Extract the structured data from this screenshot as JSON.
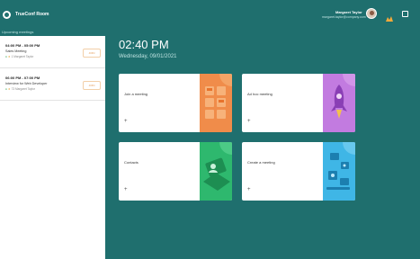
{
  "app": {
    "title": "TrueConf Room"
  },
  "user": {
    "name": "Margaret Taylor",
    "email": "margaret.taylor@company.com"
  },
  "sidebar": {
    "header": "Upcoming meetings",
    "meetings": [
      {
        "time": "04:00 PM - 05:00 PM",
        "title": "Sales Meeting",
        "meta": "1  Margaret Taylor",
        "button": "JOIN"
      },
      {
        "time": "06:00 PM - 07:00 PM",
        "title": "Interview for Web Developer",
        "meta": "73  Margaret Taylor",
        "button": "JOIN"
      }
    ]
  },
  "main": {
    "time": "02:40 PM",
    "date": "Wednesday, 09/01/2021",
    "cards": [
      {
        "label": "Join a meeting",
        "plus": "+",
        "art_color": "#f08c4a",
        "art_icon": "grid-icon"
      },
      {
        "label": "Ad hoc meeting",
        "plus": "+",
        "art_color": "#c27be0",
        "art_icon": "rocket-icon"
      },
      {
        "label": "Contacts",
        "plus": "+",
        "art_color": "#2eb86e",
        "art_icon": "contacts-icon"
      },
      {
        "label": "Create a meeting",
        "plus": "+",
        "art_color": "#3fb6e6",
        "art_icon": "schedule-icon"
      }
    ]
  },
  "colors": {
    "background": "#1f6f6e",
    "sidebar": "#ffffff",
    "accent": "#e39a55"
  }
}
